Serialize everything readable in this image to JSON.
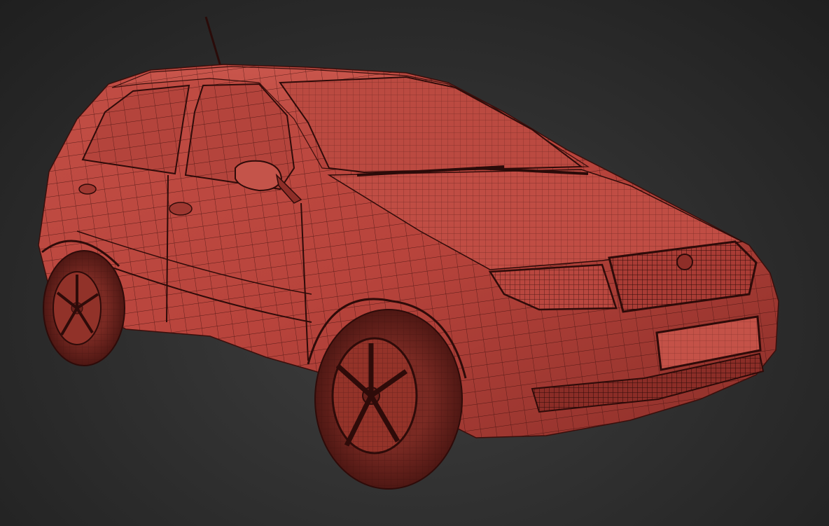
{
  "scene": {
    "subject": "car",
    "render_mode": "wireframe-on-shaded",
    "colors": {
      "background_center": "#3e3e3e",
      "background_edge": "#1f1f1f",
      "body_fill": "#b8443c",
      "body_highlight": "#d6675d",
      "body_shadow": "#6e221d",
      "wire": "#3a0f0c",
      "tire": "#6a221c"
    }
  }
}
